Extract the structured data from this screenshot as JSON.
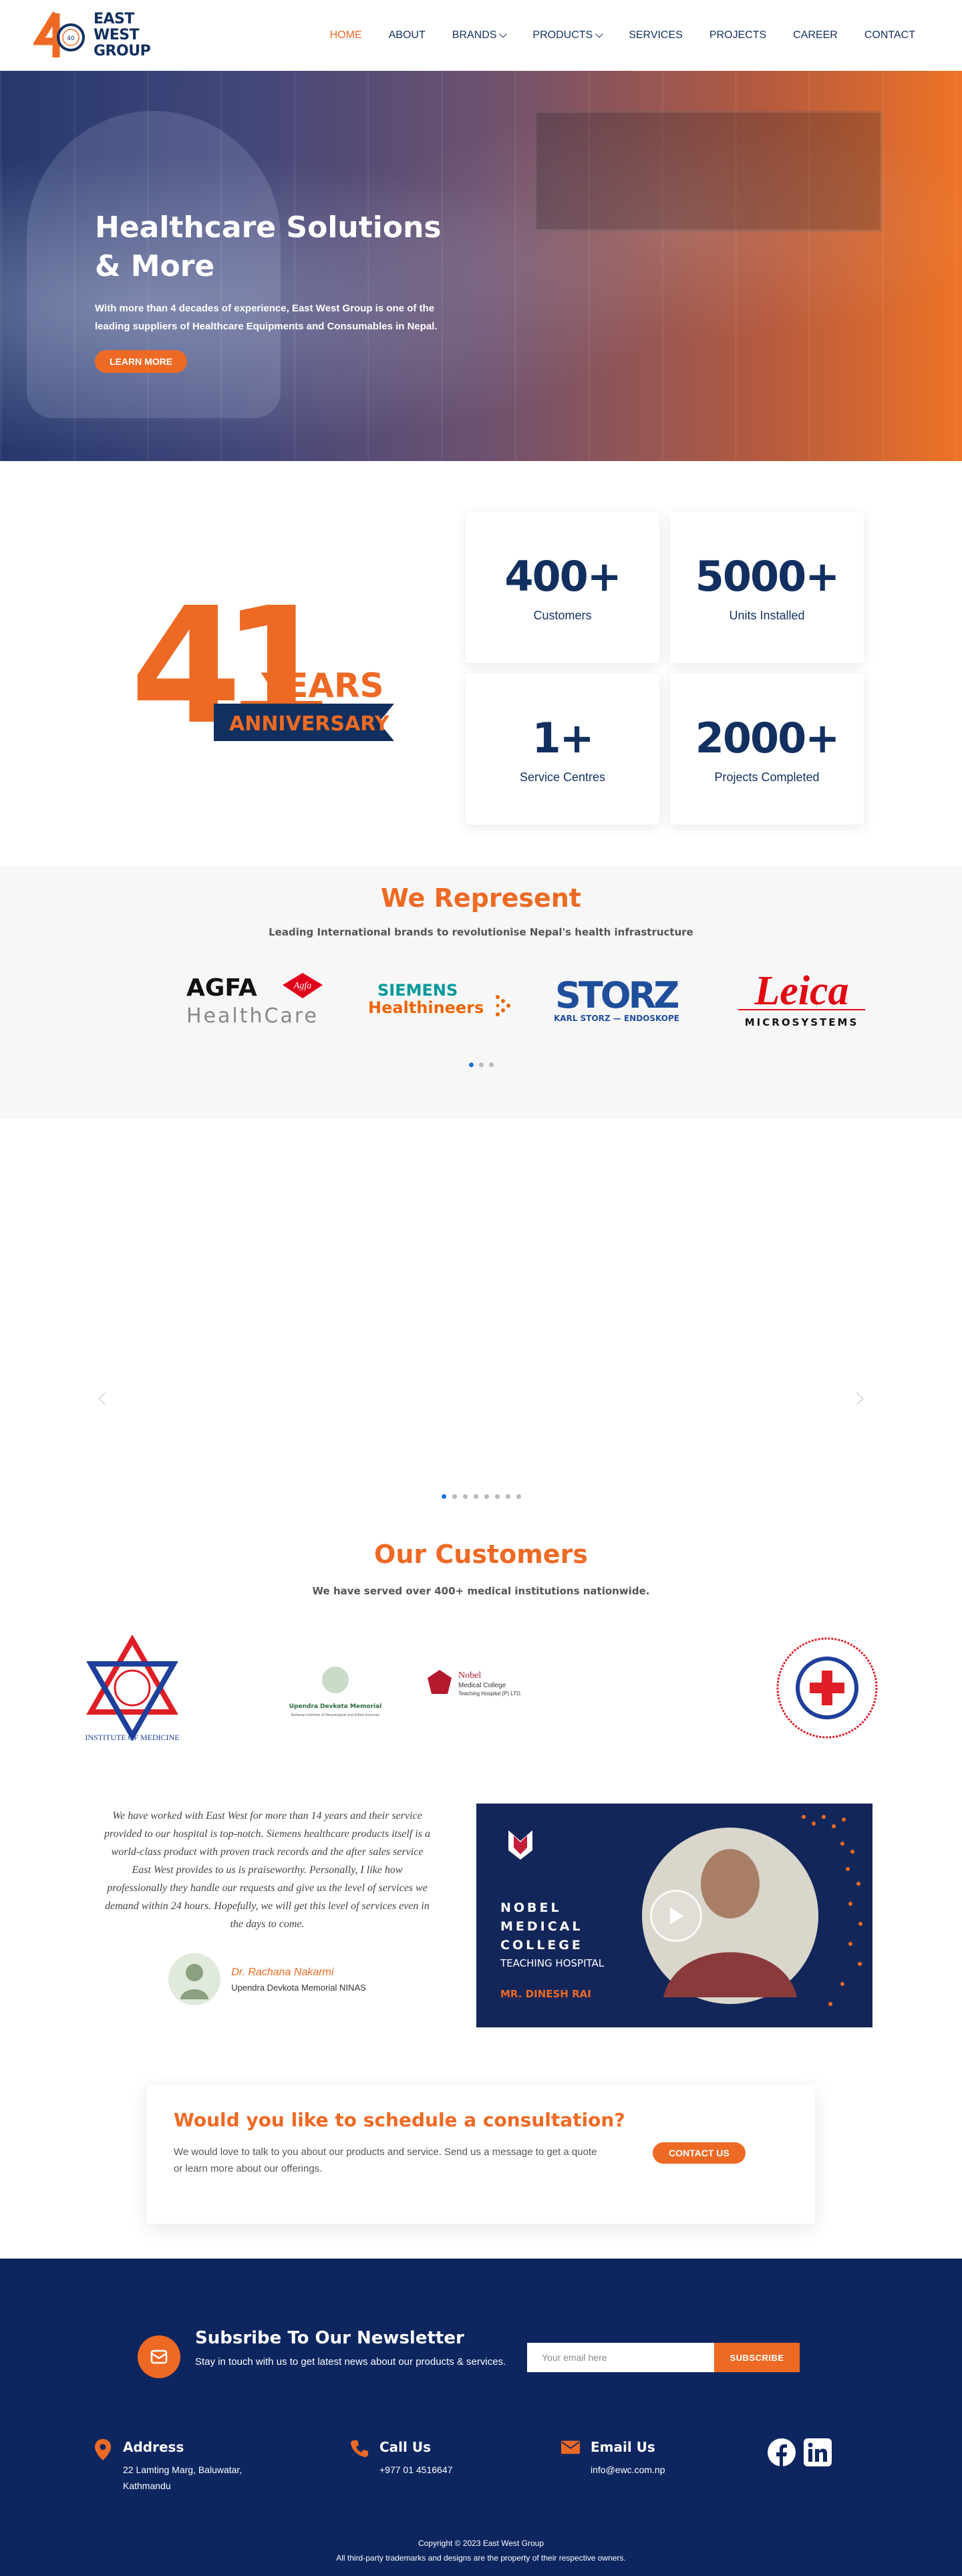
{
  "brand": {
    "line1": "EAST",
    "line2": "WEST",
    "line3": "GROUP",
    "mark_number": "40"
  },
  "nav": [
    {
      "label": "HOME",
      "active": true,
      "dropdown": false
    },
    {
      "label": "ABOUT",
      "active": false,
      "dropdown": false
    },
    {
      "label": "BRANDS",
      "active": false,
      "dropdown": true
    },
    {
      "label": "PRODUCTS",
      "active": false,
      "dropdown": true
    },
    {
      "label": "SERVICES",
      "active": false,
      "dropdown": false
    },
    {
      "label": "PROJECTS",
      "active": false,
      "dropdown": false
    },
    {
      "label": "CAREER",
      "active": false,
      "dropdown": false
    },
    {
      "label": "CONTACT",
      "active": false,
      "dropdown": false
    }
  ],
  "hero": {
    "title_line1": "Healthcare Solutions",
    "title_line2": "& More",
    "subtitle_line1": "With more than 4 decades of experience, East West Group is one of the",
    "subtitle_line2": "leading suppliers of Healthcare Equipments and Consumables in Nepal.",
    "cta": "LEARN MORE"
  },
  "anniversary": {
    "number": "41",
    "word1": "YEARS",
    "word2": "ANNIVERSARY"
  },
  "stats": [
    {
      "value": "400+",
      "label": "Customers"
    },
    {
      "value": "5000+",
      "label": "Units Installed"
    },
    {
      "value": "1+",
      "label": "Service Centres"
    },
    {
      "value": "2000+",
      "label": "Projects Completed"
    }
  ],
  "represent": {
    "title": "We Represent",
    "subtitle": "Leading International brands to revolutionise Nepal's health infrastructure",
    "brands": {
      "agfa_word": "AGFA",
      "agfa_badge": "Agfa",
      "agfa_sub": "HealthCare",
      "siemens_word": "SIEMENS",
      "siemens_sub": "Healthineers",
      "storz_word": "STORZ",
      "storz_sub": "KARL STORZ — ENDOSKOPE",
      "leica_word": "Leica",
      "leica_sub": "MICROSYSTEMS"
    },
    "dots_total": 3,
    "dots_active": 0
  },
  "slider2": {
    "dots_total": 8,
    "dots_active": 0
  },
  "customers": {
    "title": "Our Customers",
    "subtitle": "We have served over 400+ medical institutions nationwide.",
    "logos": {
      "iom": "INSTITUTE OF MEDICINE",
      "updev_title": "Upendra Devkota Memorial",
      "updev_sub": "National Institute of Neurological and Allied Sciences",
      "nobel_l1": "Nobel",
      "nobel_l2": "Medical College",
      "nobel_l3": "Teaching Hospital (P) LTD."
    }
  },
  "testimonial": {
    "quote": "We have worked with East West for more than 14 years and their service provided to our hospital is top-notch. Siemens healthcare products itself is a world-class product with proven track records and the after sales service East West provides to us is praiseworthy. Personally, I like how professionally they handle our requests and give us the level of services we demand within 24 hours. Hopefully, we will get this level of services even in the days to come.",
    "name": "Dr. Rachana Nakarmi",
    "org": "Upendra Devkota Memorial NINAS"
  },
  "video": {
    "line1": "NOBEL",
    "line2": "MEDICAL",
    "line3": "COLLEGE",
    "line4": "TEACHING HOSPITAL",
    "speaker": "MR. DINESH RAI"
  },
  "consult": {
    "title": "Would you like to schedule a consultation?",
    "text": "We would love to talk to you about our products and service. Send us a message to get a quote or learn more about our offerings.",
    "cta": "CONTACT US"
  },
  "newsletter": {
    "title": "Subsribe To Our Newsletter",
    "text": "Stay in touch with us to get latest news about our products & services.",
    "placeholder": "Your email here",
    "button": "SUBSCRIBE"
  },
  "contact": {
    "address_title": "Address",
    "address_line1": "22 Lamting Marg, Baluwatar,",
    "address_line2": "Kathmandu",
    "call_title": "Call Us",
    "call_value": "+977 01 4516647",
    "email_title": "Email Us",
    "email_value": "info@ewc.com.np"
  },
  "footer": {
    "copyright": "Copyright © 2023 East West Group",
    "trademark": "All third-party trademarks and designs are the property of their respective owners."
  },
  "colors": {
    "orange": "#ee6a24",
    "navy": "#12305f",
    "footer_bg": "#0d2660",
    "dot_active": "#1c6fd8"
  }
}
